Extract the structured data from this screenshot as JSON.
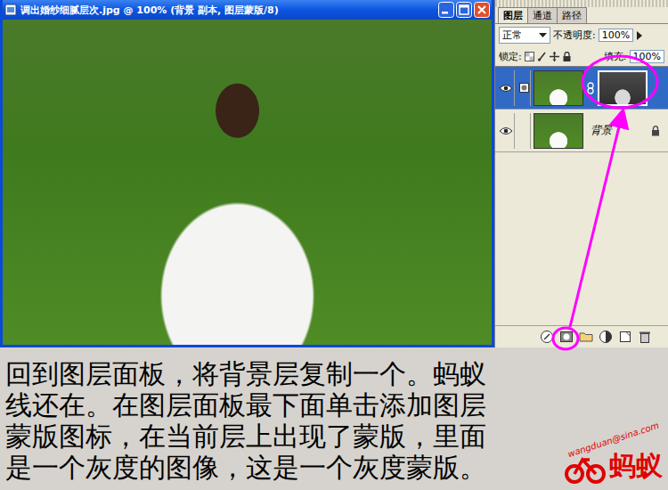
{
  "image_window": {
    "title": "调出婚纱细腻层次.jpg @ 100% (背景 副本, 图层蒙版/8)"
  },
  "layers_panel": {
    "tabs": [
      {
        "label": "图层",
        "selected": true
      },
      {
        "label": "通道",
        "selected": false
      },
      {
        "label": "路径",
        "selected": false
      }
    ],
    "blend_mode": "正常",
    "opacity_label": "不透明度:",
    "opacity": "100%",
    "lock_label": "锁定:",
    "fill_label": "填充:",
    "fill": "100%",
    "layers": [
      {
        "kind": "masked",
        "visible": true,
        "selected": true,
        "locked": false
      },
      {
        "kind": "plain",
        "name": "背景",
        "visible": true,
        "selected": false,
        "locked": true
      }
    ]
  },
  "caption": "回到图层面板，将背景层复制一个。蚂蚁线还在。在图层面板最下面单击添加图层蒙版图标，在当前层上出现了蒙版，里面是一个灰度的图像，这是一个灰度蒙版。",
  "watermark": {
    "email": "wangduan@sina.com",
    "logo": "蚂蚁"
  }
}
